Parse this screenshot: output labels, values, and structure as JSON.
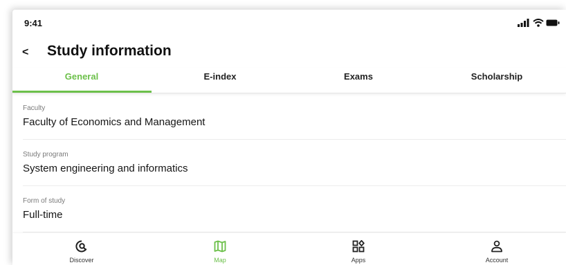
{
  "statusbar": {
    "time": "9:41",
    "icons": [
      "signal-icon",
      "wifi-icon",
      "battery-icon"
    ]
  },
  "header": {
    "back_icon": "chevron-left-icon",
    "back_glyph": "<",
    "title": "Study information"
  },
  "tabs": [
    {
      "label": "General",
      "active": true
    },
    {
      "label": "E-index",
      "active": false
    },
    {
      "label": "Exams",
      "active": false
    },
    {
      "label": "Scholarship",
      "active": false
    }
  ],
  "fields": [
    {
      "label": "Faculty",
      "value": "Faculty of Economics and Management"
    },
    {
      "label": "Study program",
      "value": "System engineering and informatics"
    },
    {
      "label": "Form of study",
      "value": "Full-time"
    }
  ],
  "bottom_nav": [
    {
      "label": "Discover",
      "icon": "discover-icon",
      "active": false
    },
    {
      "label": "Map",
      "icon": "map-icon",
      "active": true
    },
    {
      "label": "Apps",
      "icon": "apps-icon",
      "active": false
    },
    {
      "label": "Account",
      "icon": "account-icon",
      "active": false
    }
  ],
  "colors": {
    "accent": "#6cc04a",
    "text": "#151515",
    "muted": "#7a7a7a",
    "divider": "#ececec"
  }
}
